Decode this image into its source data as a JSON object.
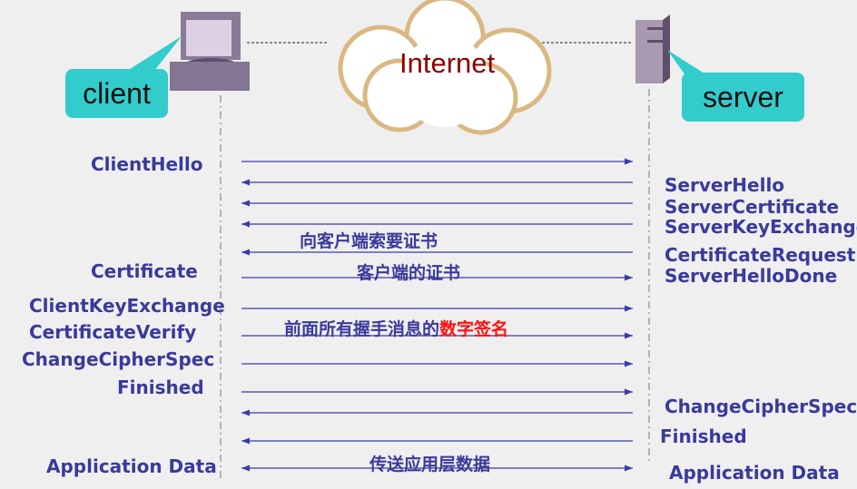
{
  "header": {
    "client_label": "client",
    "server_label": "server",
    "network_label": "Internet"
  },
  "colors": {
    "text": "#3a3a9c",
    "arrow": "#3a3aa8",
    "highlight": "#ff1010",
    "bubble": "#33cccc",
    "cloud": "#dab882"
  },
  "left_messages": [
    "ClientHello",
    "Certificate",
    "ClientKeyExchange",
    "CertificateVerify",
    "ChangeCipherSpec",
    "Finished",
    "Application Data"
  ],
  "right_messages": [
    "ServerHello",
    "ServerCertificate",
    "ServerKeyExchange",
    "CertificateRequest",
    "ServerHelloDone",
    "ChangeCipherSpec",
    "Finished",
    "Application Data"
  ],
  "annotations": {
    "request_cert": "向客户端索要证书",
    "client_cert": "客户端的证书",
    "signature_prefix": "前面所有握手消息的",
    "signature_highlight": "数字签名",
    "app_data": "传送应用层数据"
  },
  "arrows": [
    "right",
    "left",
    "left",
    "left",
    "left",
    "right",
    "right",
    "right",
    "right",
    "right",
    "left",
    "left",
    "both"
  ]
}
